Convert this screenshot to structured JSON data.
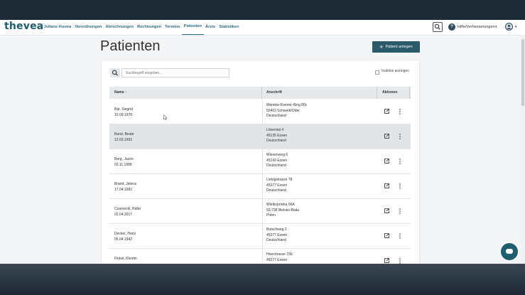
{
  "app": {
    "logo": "thevea",
    "nav": [
      {
        "label": "Julians thevea",
        "active": false
      },
      {
        "label": "Verordnungen",
        "active": false
      },
      {
        "label": "Abrechnungen",
        "active": false
      },
      {
        "label": "Rechnungen",
        "active": false
      },
      {
        "label": "Termine",
        "active": false
      },
      {
        "label": "Patienten",
        "active": true
      },
      {
        "label": "Ärzte",
        "active": false
      },
      {
        "label": "Statistiken",
        "active": false
      }
    ],
    "help_icon": "?",
    "help_label": "Hilfe/Verbesserungen",
    "caret": "▾",
    "accent_color": "#2b5a6a"
  },
  "page": {
    "title": "Patienten",
    "add_button": "Patient anlegen",
    "add_icon": "+",
    "search_placeholder": "Suchbegriff eingeben...",
    "inactive_label": "Inaktive anzeigen"
  },
  "table": {
    "headers": {
      "name": "Name ↑",
      "address": "Anschrift",
      "actions": "Aktionen"
    },
    "rows": [
      {
        "name": "Bär, Siegrid",
        "dob": "10.09.1978",
        "street": "Mareike-Kremer-Ring 80c",
        "city": "50402 Schwedt/Oder",
        "country": "Deutschland"
      },
      {
        "name": "Band, Beate",
        "dob": "12.03.1963",
        "street": "Löwental 4",
        "city": "45135 Essen",
        "country": "Deutschland"
      },
      {
        "name": "Berg, Jason",
        "dob": "03.11.1988",
        "street": "Wiesenweg 6",
        "city": "45143 Essen",
        "country": "Deutschland"
      },
      {
        "name": "Brand, Jelena",
        "dob": "17.04.1982",
        "street": "Liebigstrasse 78",
        "city": "45277 Essen",
        "country": "Deutschland"
      },
      {
        "name": "Czarnecki, Rafał",
        "dob": "02.04.2017",
        "street": "Wielkopolska 66A",
        "city": "93-738 Bielsko-Biała",
        "country": "Polen"
      },
      {
        "name": "Decker, Hans",
        "dob": "05.04.1942",
        "street": "Butschweg 2",
        "city": "45277 Essen",
        "country": "Deutschland"
      },
      {
        "name": "Finkel, Kerstin",
        "dob": "",
        "street": "Heerstrasse 15b",
        "city": "45277 Essen",
        "country": ""
      }
    ]
  }
}
